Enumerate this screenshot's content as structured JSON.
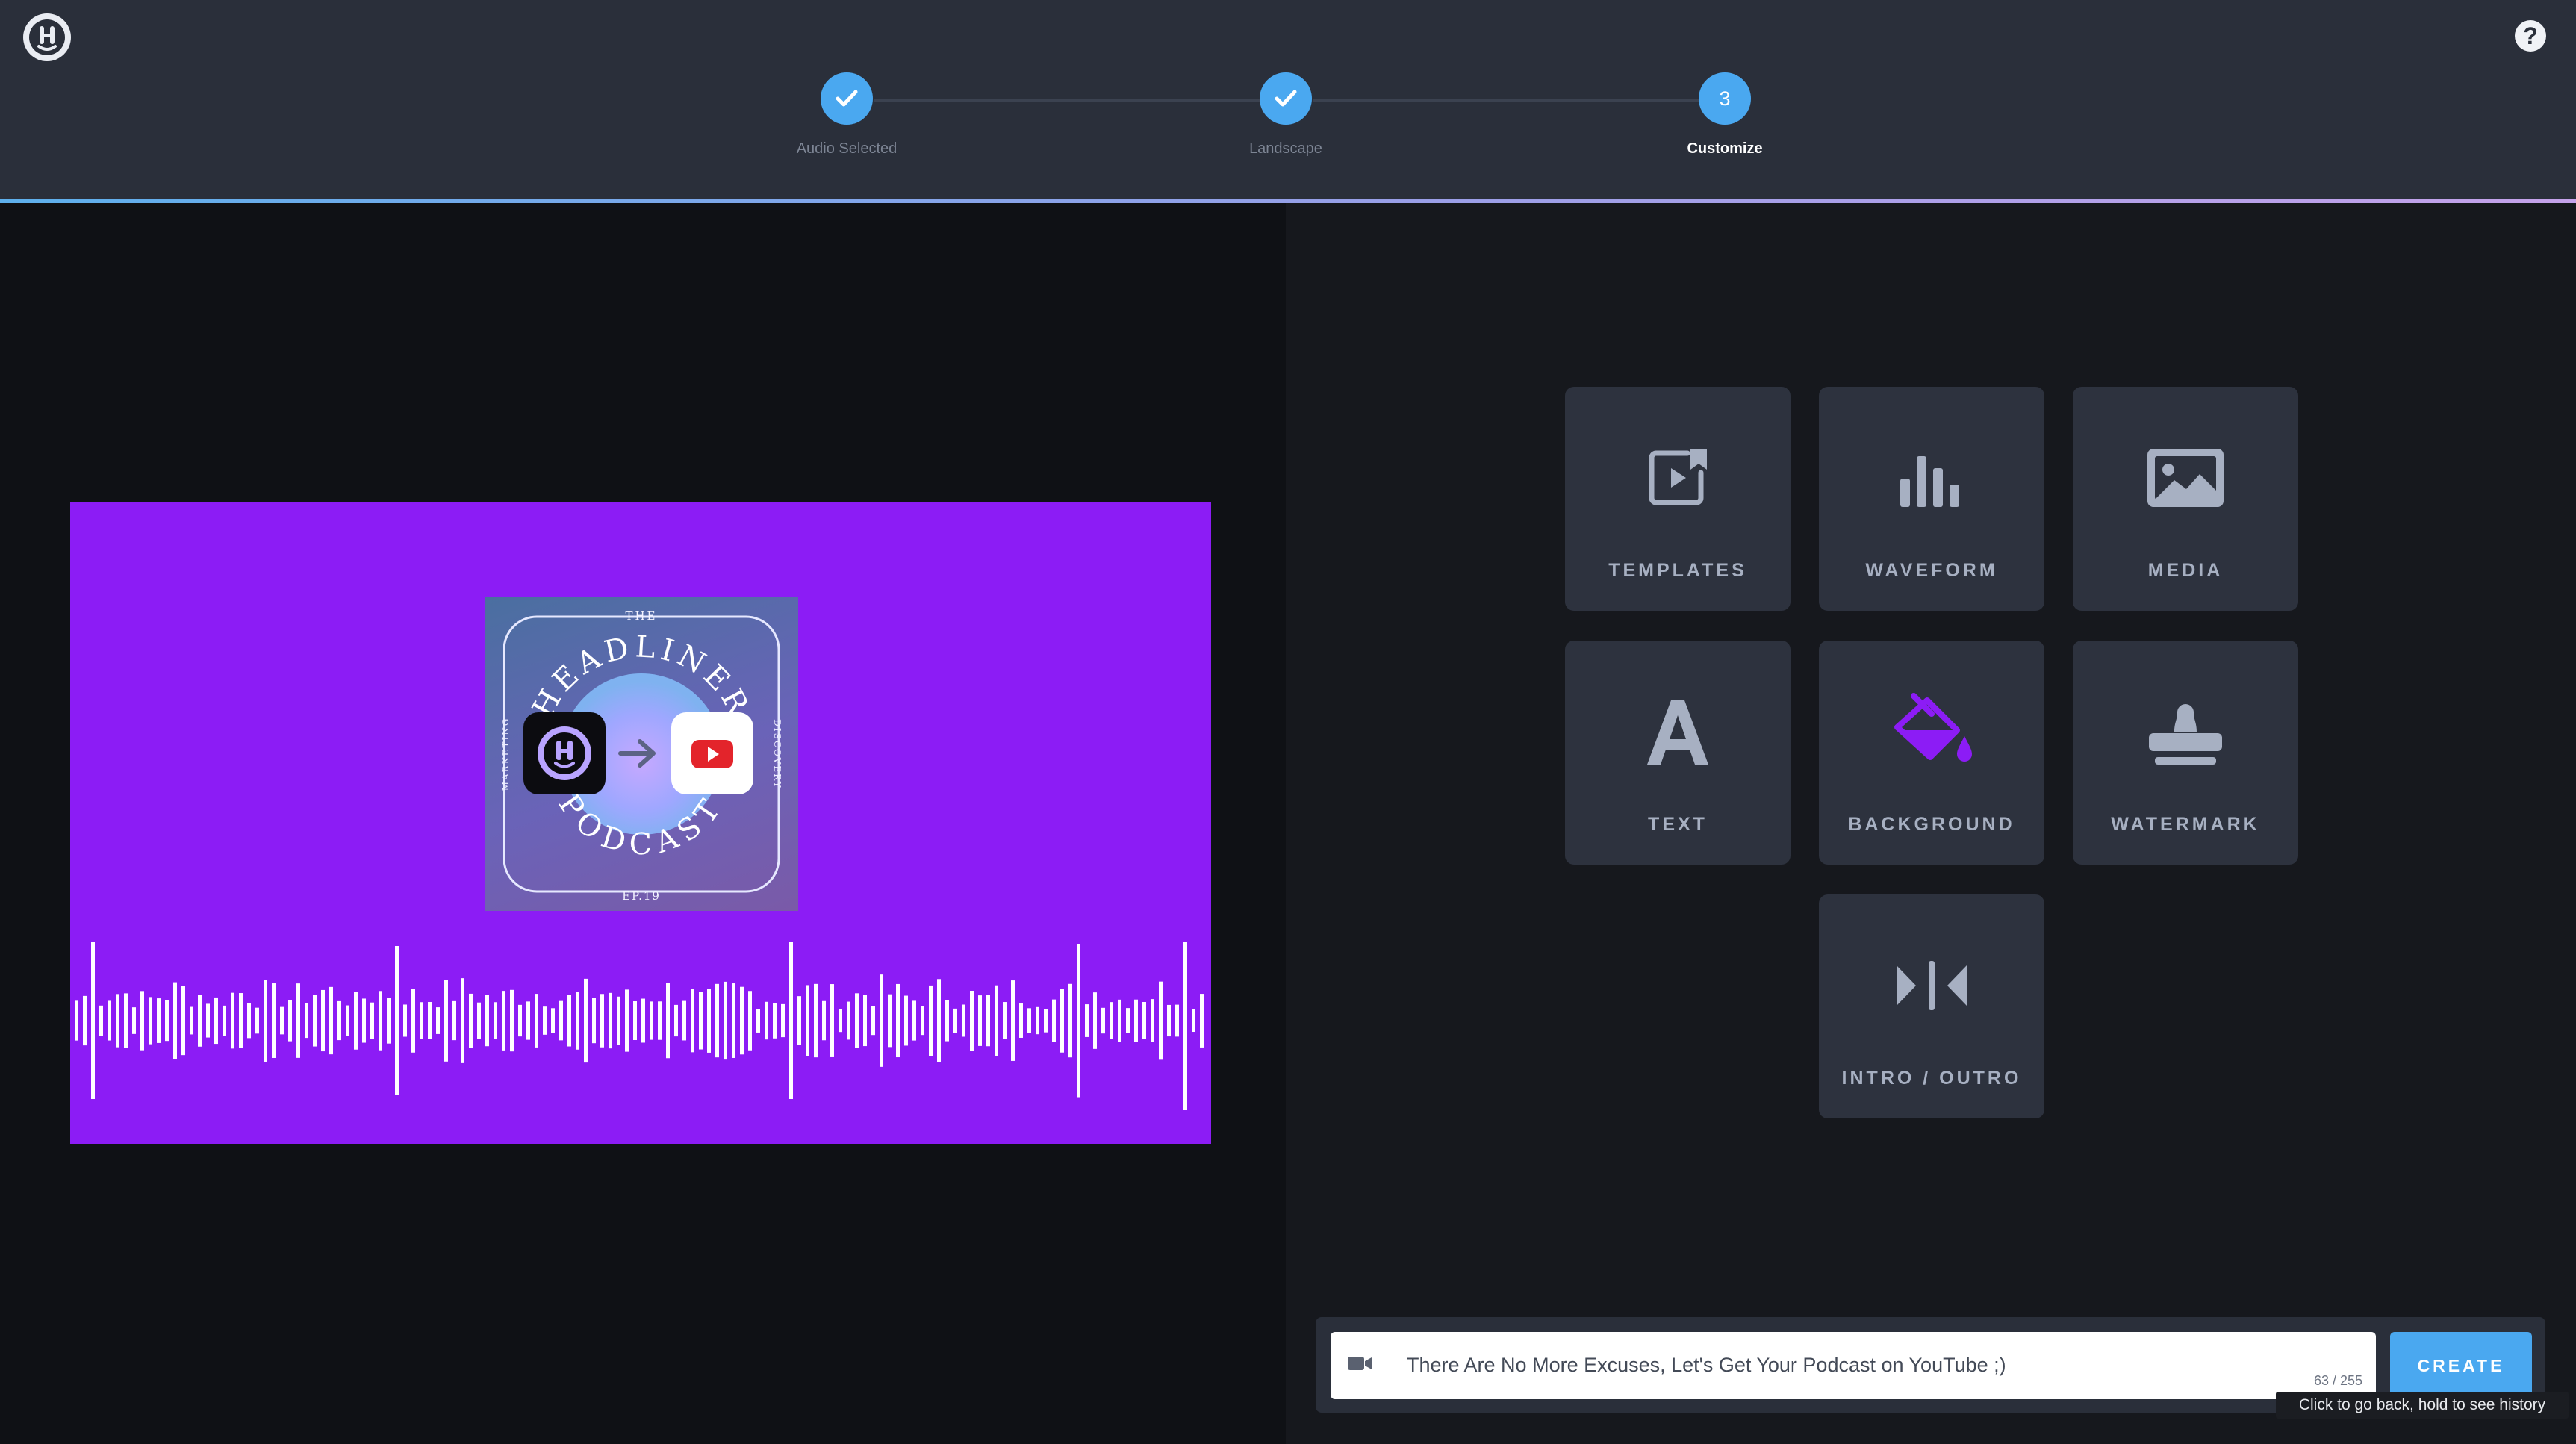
{
  "header": {
    "help_symbol": "?",
    "steps": [
      {
        "label": "Audio Selected",
        "state": "complete"
      },
      {
        "label": "Landscape",
        "state": "complete"
      },
      {
        "label": "Customize",
        "state": "active",
        "number": "3"
      }
    ]
  },
  "preview": {
    "background_color": "#8c1cf5",
    "cover": {
      "top_text": "THE",
      "arc_top": "HEADLINER",
      "arc_bottom": "PODCAST",
      "side_left": "MARKETING",
      "side_right": "DISCOVERY",
      "episode": "EP.19"
    }
  },
  "tools": [
    {
      "label": "TEMPLATES",
      "icon": "video-template-icon"
    },
    {
      "label": "WAVEFORM",
      "icon": "waveform-bars-icon"
    },
    {
      "label": "MEDIA",
      "icon": "image-icon"
    },
    {
      "label": "TEXT",
      "icon": "text-a-icon"
    },
    {
      "label": "BACKGROUND",
      "icon": "paint-bucket-icon",
      "highlight": "#8c1cf5"
    },
    {
      "label": "WATERMARK",
      "icon": "stamp-icon"
    },
    {
      "label": "INTRO / OUTRO",
      "icon": "intro-outro-icon"
    }
  ],
  "project": {
    "title_value": "There Are No More Excuses, Let's Get Your Podcast on YouTube ;)",
    "char_count": "63 / 255",
    "create_label": "CREATE",
    "tooltip": "Click to go back, hold to see history"
  },
  "colors": {
    "accent": "#4aa8f0",
    "header_bg": "#2a2f3a",
    "tool_bg": "#2d323e"
  }
}
